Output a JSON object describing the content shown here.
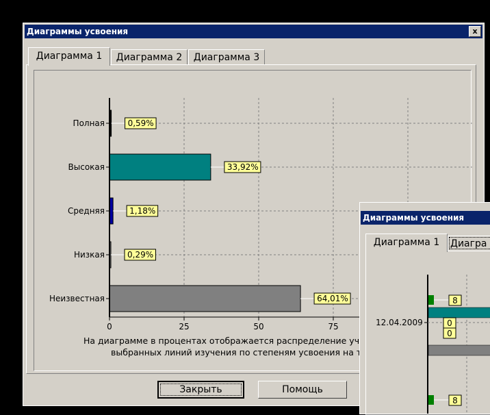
{
  "window1": {
    "title": "Диаграммы усвоения",
    "close_glyph": "x",
    "tabs": [
      {
        "label": "Диаграмма 1",
        "active": true
      },
      {
        "label": "Диаграмма 2",
        "active": false
      },
      {
        "label": "Диаграмма 3",
        "active": false
      }
    ],
    "caption_line1": "На диаграмме в процентах отображается распределение уч",
    "caption_line2": "выбранных линий изучения по степеням усвоения на те",
    "buttons": {
      "close": "Закрыть",
      "help": "Помощь"
    }
  },
  "chart_data": {
    "type": "bar",
    "orientation": "horizontal",
    "categories": [
      "Полная",
      "Высокая",
      "Средняя",
      "Низкая",
      "Неизвестная"
    ],
    "values": [
      0.59,
      33.92,
      1.18,
      0.29,
      64.01
    ],
    "value_labels": [
      "0,59%",
      "33,92%",
      "1,18%",
      "0,29%",
      "64,01%"
    ],
    "colors": [
      "#000000",
      "#008080",
      "#0000a0",
      "#808080",
      "#808080"
    ],
    "x_ticks": [
      "0",
      "25",
      "50",
      "75"
    ],
    "xlim": [
      0,
      100
    ],
    "grid": true
  },
  "window2": {
    "title": "Диаграммы усвоения",
    "tabs": [
      {
        "label": "Диаграмма 1",
        "active": true
      },
      {
        "label": "Диагра",
        "active": false
      }
    ],
    "row_label": "12.04.2009",
    "value_labels": [
      "8",
      "0",
      "0",
      "8"
    ],
    "colors": {
      "green": "#008000",
      "teal": "#008080",
      "gray": "#808080"
    }
  }
}
